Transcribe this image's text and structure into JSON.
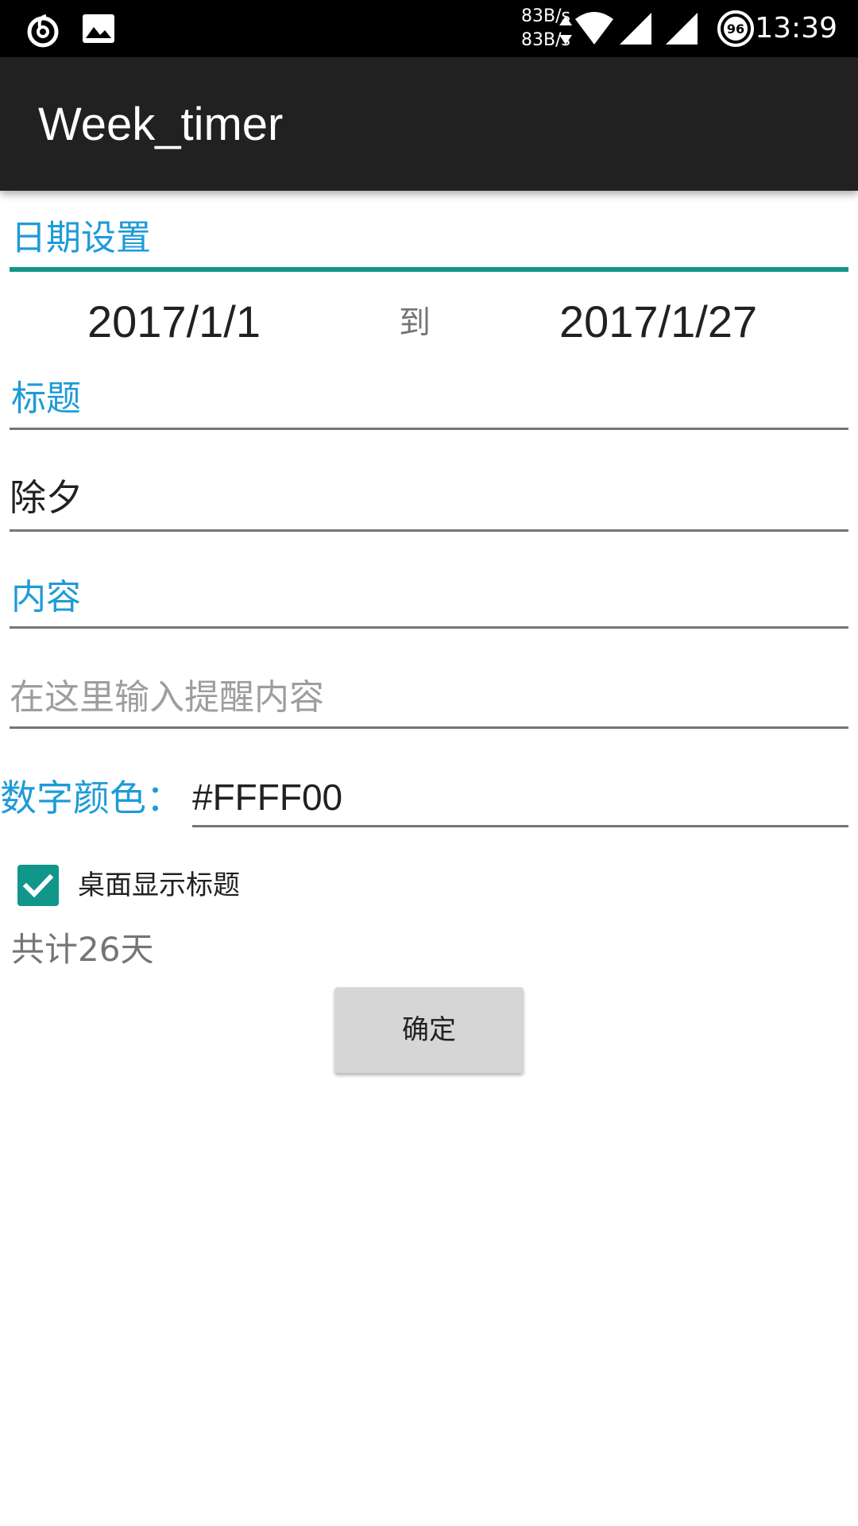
{
  "status_bar": {
    "speed_up": "83B/s",
    "speed_down": "83B/s",
    "battery_level": "96",
    "time": "13:39",
    "icons": [
      "netease-music-icon",
      "image-icon",
      "wifi-icon",
      "signal-icon",
      "signal-icon",
      "battery-icon"
    ]
  },
  "app_bar": {
    "title": "Week_timer"
  },
  "date_section": {
    "label": "日期设置",
    "start_date": "2017/1/1",
    "separator": "到",
    "end_date": "2017/1/27"
  },
  "title_section": {
    "label": "标题",
    "value": "除夕"
  },
  "content_section": {
    "label": "内容",
    "placeholder": "在这里输入提醒内容"
  },
  "color_section": {
    "label": "数字颜色：",
    "value": "#FFFF00"
  },
  "show_title_checkbox": {
    "label": "桌面显示标题",
    "checked": true
  },
  "total": {
    "text": "共计26天"
  },
  "confirm_button": {
    "label": "确定"
  },
  "colors": {
    "accent_blue": "#1e9bd8",
    "teal": "#11968a",
    "app_bar": "#212121"
  }
}
